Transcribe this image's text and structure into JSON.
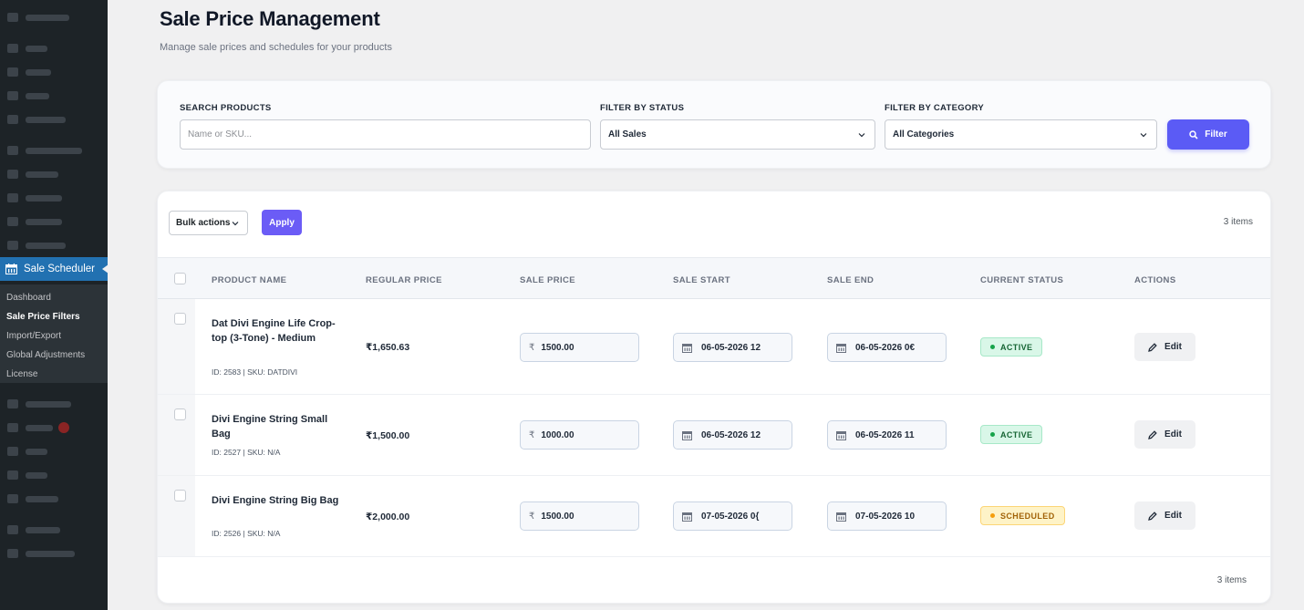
{
  "sidebar": {
    "active_label": "Sale Scheduler",
    "submenu": [
      "Dashboard",
      "Sale Price Filters",
      "Import/Export",
      "Global Adjustments",
      "License"
    ],
    "current_submenu_index": 1
  },
  "header": {
    "title": "Sale Price Management",
    "subtitle": "Manage sale prices and schedules for your products"
  },
  "filters": {
    "search_label": "SEARCH PRODUCTS",
    "search_placeholder": "Name or SKU...",
    "status_label": "FILTER BY STATUS",
    "status_value": "All Sales",
    "category_label": "FILTER BY CATEGORY",
    "category_value": "All Categories",
    "filter_button": "Filter"
  },
  "toolbar": {
    "bulk_actions": "Bulk actions",
    "apply": "Apply",
    "item_count_top": "3 items",
    "item_count_bottom": "3 items"
  },
  "table": {
    "columns": [
      "PRODUCT NAME",
      "REGULAR PRICE",
      "SALE PRICE",
      "SALE START",
      "SALE END",
      "CURRENT STATUS",
      "ACTIONS"
    ],
    "rows": [
      {
        "name": "Dat Divi Engine Life Crop-top (3-Tone) - Medium",
        "meta": "ID: 2583 | SKU: DATDIVI",
        "regular_price": "₹1,650.63",
        "currency": "₹",
        "sale_price": "1500.00",
        "sale_start": "06-05-2026 12",
        "sale_end": "06-05-2026 0€",
        "status": "ACTIVE",
        "action": "Edit"
      },
      {
        "name": "Divi Engine String Small Bag",
        "meta": "ID: 2527 | SKU: N/A",
        "regular_price": "₹1,500.00",
        "currency": "₹",
        "sale_price": "1000.00",
        "sale_start": "06-05-2026 12",
        "sale_end": "06-05-2026 11",
        "status": "ACTIVE",
        "action": "Edit"
      },
      {
        "name": "Divi Engine String Big Bag",
        "meta": "ID: 2526 | SKU: N/A",
        "regular_price": "₹2,000.00",
        "currency": "₹",
        "sale_price": "1500.00",
        "sale_start": "07-05-2026 0{",
        "sale_end": "07-05-2026 10",
        "status": "SCHEDULED",
        "action": "Edit"
      }
    ]
  },
  "colors": {
    "accent": "#5b5bf5",
    "wp_admin_blue": "#2271b1",
    "active_green": "#16a34a",
    "scheduled_amber": "#f59e0b"
  },
  "icons": [
    "calendar-icon",
    "search-icon",
    "chevron-down-icon",
    "pencil-icon"
  ]
}
